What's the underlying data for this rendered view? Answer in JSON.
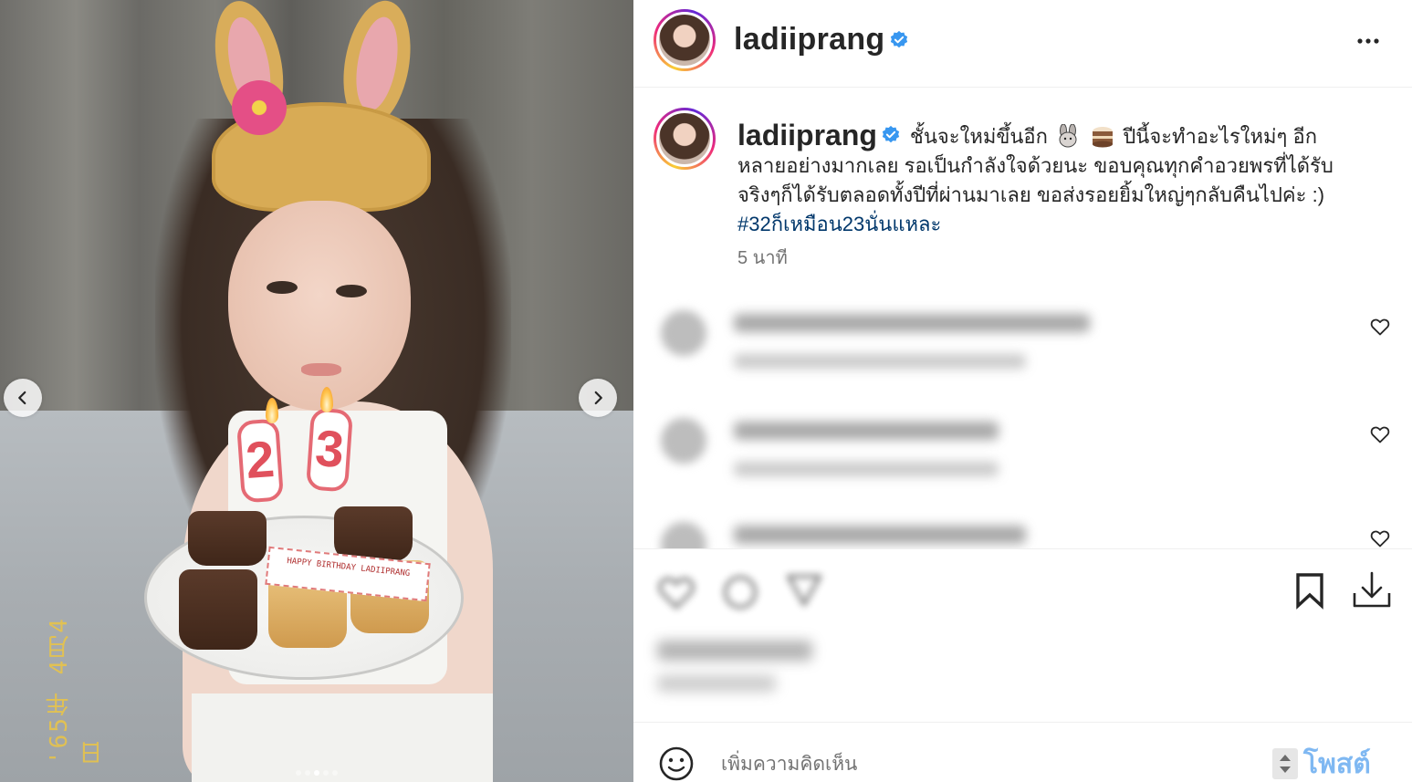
{
  "post": {
    "username": "ladiiprang",
    "verified": true,
    "caption_line1": "ชั้นจะใหม่ขึ้นอีก",
    "caption_line1b": "ปีนี้จะทำอะไรใหม่ๆ อีก",
    "caption_line2": "หลายอย่างมากเลย รอเป็นกำลังใจด้วยนะ ขอบคุณทุกคำอวยพรที่ได้รับ",
    "caption_line3": "จริงๆก็ได้รับตลอดทั้งปีที่ผ่านมาเลย ขอส่งรอยยิ้มใหญ่ๆกลับคืนไปค่ะ :)",
    "hashtag": "#32ก็เหมือน23นั่นแหละ",
    "time_ago": "5 นาที",
    "caption_emojis": [
      "rabbit",
      "cake"
    ]
  },
  "photo": {
    "card_text": "HAPPY BIRTHDAY LADIIPRANG",
    "candles": [
      "2",
      "3"
    ],
    "date_stamp": "'65年 4月4日",
    "carousel_dots": 5,
    "active_dot": 3
  },
  "comment_box": {
    "placeholder": "เพิ่มความคิดเห็น",
    "post_label": "โพสต์"
  },
  "colors": {
    "verified": "#3897f0",
    "hashtag": "#00376b",
    "post_button": "#7fb8f2",
    "text": "#262626",
    "muted": "#737373"
  },
  "icons": {
    "more": "ellipsis-icon",
    "prev": "chevron-left-icon",
    "next": "chevron-right-icon",
    "save": "bookmark-icon",
    "download": "download-icon",
    "like": "heart-icon",
    "emoji": "smiley-icon"
  }
}
